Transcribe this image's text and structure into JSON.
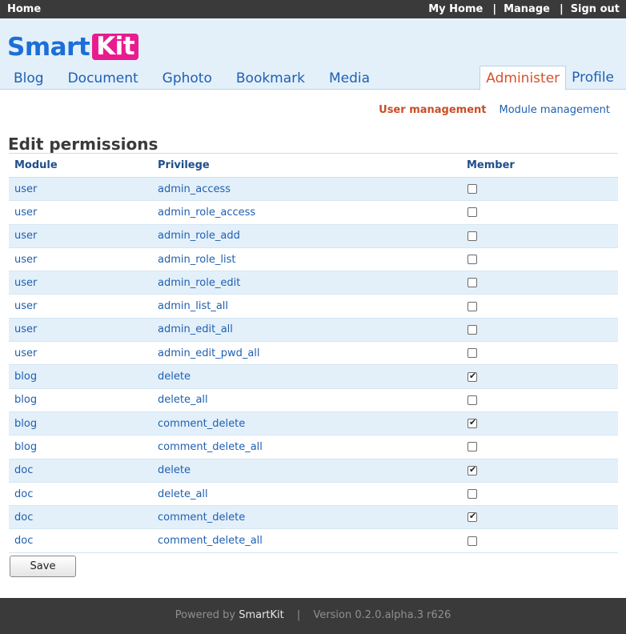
{
  "topbar": {
    "home": "Home",
    "my_home": "My Home",
    "manage": "Manage",
    "sign_out": "Sign out",
    "separator": "|"
  },
  "logo": {
    "part1": "Smart",
    "part2": "Kit"
  },
  "nav": {
    "items": [
      "Blog",
      "Document",
      "Gphoto",
      "Bookmark",
      "Media"
    ]
  },
  "tabs": {
    "administer": "Administer",
    "profile": "Profile"
  },
  "subnav": {
    "user_management": "User management",
    "module_management": "Module management"
  },
  "page": {
    "title": "Edit permissions"
  },
  "table": {
    "headers": [
      "Module",
      "Privilege",
      "Member"
    ],
    "rows": [
      {
        "module": "user",
        "privilege": "admin_access",
        "member": false
      },
      {
        "module": "user",
        "privilege": "admin_role_access",
        "member": false
      },
      {
        "module": "user",
        "privilege": "admin_role_add",
        "member": false
      },
      {
        "module": "user",
        "privilege": "admin_role_list",
        "member": false
      },
      {
        "module": "user",
        "privilege": "admin_role_edit",
        "member": false
      },
      {
        "module": "user",
        "privilege": "admin_list_all",
        "member": false
      },
      {
        "module": "user",
        "privilege": "admin_edit_all",
        "member": false
      },
      {
        "module": "user",
        "privilege": "admin_edit_pwd_all",
        "member": false
      },
      {
        "module": "blog",
        "privilege": "delete",
        "member": true
      },
      {
        "module": "blog",
        "privilege": "delete_all",
        "member": false
      },
      {
        "module": "blog",
        "privilege": "comment_delete",
        "member": true
      },
      {
        "module": "blog",
        "privilege": "comment_delete_all",
        "member": false
      },
      {
        "module": "doc",
        "privilege": "delete",
        "member": true
      },
      {
        "module": "doc",
        "privilege": "delete_all",
        "member": false
      },
      {
        "module": "doc",
        "privilege": "comment_delete",
        "member": true
      },
      {
        "module": "doc",
        "privilege": "comment_delete_all",
        "member": false
      }
    ]
  },
  "form": {
    "save_label": "Save"
  },
  "footer": {
    "powered_by": "Powered by",
    "brand": "SmartKit",
    "separator": "|",
    "version": "Version 0.2.0.alpha.3 r626"
  }
}
